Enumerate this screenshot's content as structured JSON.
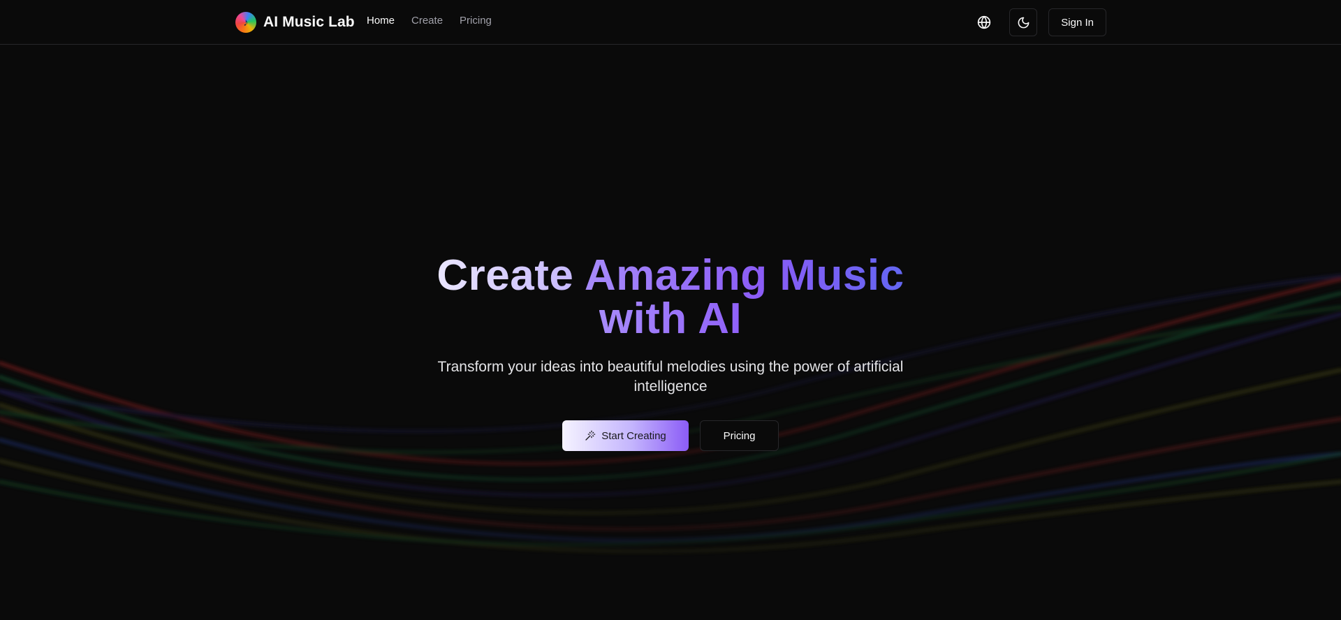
{
  "header": {
    "brand_name": "AI Music Lab",
    "logo_icon": "music-note-icon",
    "nav": [
      {
        "label": "Home",
        "active": true
      },
      {
        "label": "Create",
        "active": false
      },
      {
        "label": "Pricing",
        "active": false
      }
    ],
    "language_icon": "globe-icon",
    "theme_icon": "moon-icon",
    "sign_in_label": "Sign In"
  },
  "hero": {
    "title_part1": "Create ",
    "title_part2": "Amazing Music",
    "title_part3": "with AI",
    "subtitle": "Transform your ideas into beautiful melodies using the power of artificial intelligence",
    "primary_cta": "Start Creating",
    "primary_cta_icon": "magic-wand-icon",
    "secondary_cta": "Pricing"
  },
  "colors": {
    "background": "#0a0a0a",
    "accent_purple": "#8b5cf6",
    "accent_indigo": "#6366f1",
    "border": "#27272a"
  }
}
